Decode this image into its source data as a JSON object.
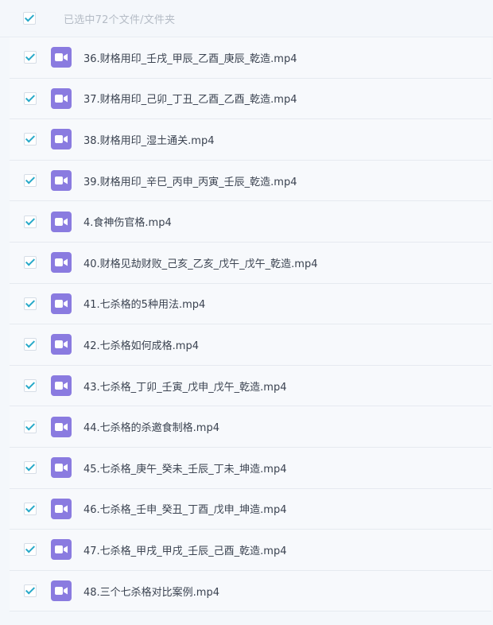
{
  "header": {
    "selected_text": "已选中72个文件/文件夹",
    "checked": true
  },
  "files": [
    {
      "name": "36.财格用印_壬戌_甲辰_乙酉_庚辰_乾造.mp4",
      "checked": true,
      "icon": "video-file-icon"
    },
    {
      "name": "37.财格用印_己卯_丁丑_乙酉_乙酉_乾造.mp4",
      "checked": true,
      "icon": "video-file-icon"
    },
    {
      "name": "38.财格用印_湿土通关.mp4",
      "checked": true,
      "icon": "video-file-icon"
    },
    {
      "name": "39.财格用印_辛巳_丙申_丙寅_壬辰_乾造.mp4",
      "checked": true,
      "icon": "video-file-icon"
    },
    {
      "name": "4.食神伤官格.mp4",
      "checked": true,
      "icon": "video-file-icon"
    },
    {
      "name": "40.财格见劫财败_己亥_乙亥_戊午_戊午_乾造.mp4",
      "checked": true,
      "icon": "video-file-icon"
    },
    {
      "name": "41.七杀格的5种用法.mp4",
      "checked": true,
      "icon": "video-file-icon"
    },
    {
      "name": "42.七杀格如何成格.mp4",
      "checked": true,
      "icon": "video-file-icon"
    },
    {
      "name": "43.七杀格_丁卯_壬寅_戊申_戊午_乾造.mp4",
      "checked": true,
      "icon": "video-file-icon"
    },
    {
      "name": "44.七杀格的杀邀食制格.mp4",
      "checked": true,
      "icon": "video-file-icon"
    },
    {
      "name": "45.七杀格_庚午_癸未_壬辰_丁未_坤造.mp4",
      "checked": true,
      "icon": "video-file-icon"
    },
    {
      "name": "46.七杀格_壬申_癸丑_丁酉_戊申_坤造.mp4",
      "checked": true,
      "icon": "video-file-icon"
    },
    {
      "name": "47.七杀格_甲戌_甲戌_壬辰_己酉_乾造.mp4",
      "checked": true,
      "icon": "video-file-icon"
    },
    {
      "name": "48.三个七杀格对比案例.mp4",
      "checked": true,
      "icon": "video-file-icon"
    }
  ],
  "colors": {
    "check_accent": "#27a9c9",
    "video_icon_bg": "#8a7be0"
  }
}
